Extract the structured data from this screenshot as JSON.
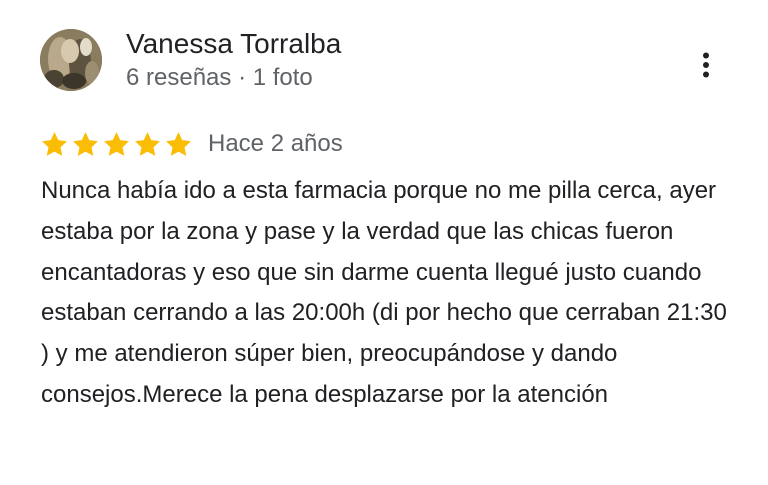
{
  "reviewer": {
    "name": "Vanessa Torralba",
    "meta": "6 reseñas · 1 foto",
    "avatar_icon": "user-photo"
  },
  "menu": {
    "icon": "more-vert-icon"
  },
  "rating": {
    "stars": 5,
    "max_stars": 5,
    "star_color": "#fbbc04",
    "date": "Hace 2 años"
  },
  "review": {
    "text": "Nunca había ido a esta farmacia porque no me pilla cerca, ayer estaba por la zona y pase y la verdad que las chicas fueron encantadoras y eso que sin darme cuenta llegué justo cuando estaban cerrando a las 20:00h (di por hecho que cerraban 21:30 ) y me atendieron súper bien, preocupándose y dando consejos.Merece la pena desplazarse por la atención"
  }
}
